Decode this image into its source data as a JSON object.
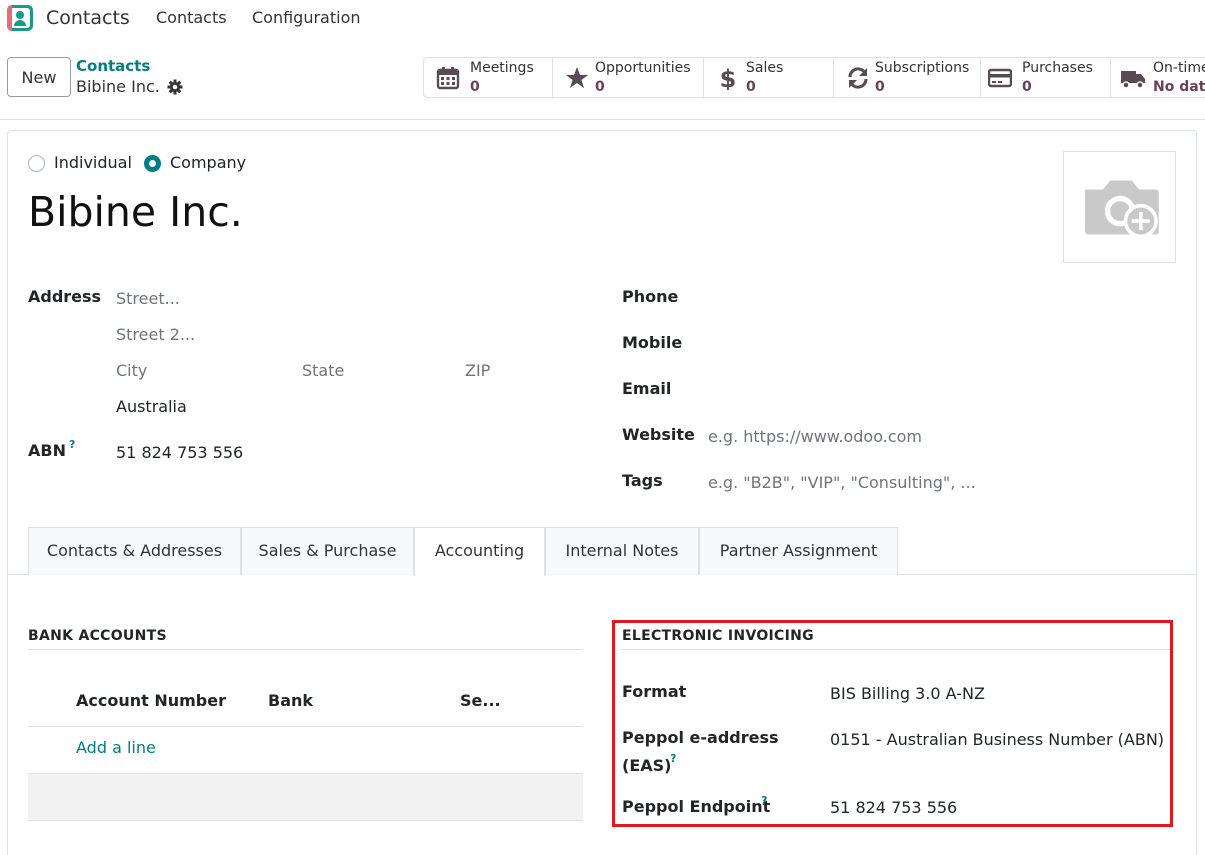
{
  "topnav": {
    "app_name": "Contacts",
    "menu": [
      "Contacts",
      "Configuration"
    ]
  },
  "control_panel": {
    "new_label": "New",
    "breadcrumb_parent": "Contacts",
    "breadcrumb_current": "Bibine Inc.",
    "smart_buttons": [
      {
        "icon": "calendar-icon",
        "label": "Meetings",
        "value": "0"
      },
      {
        "icon": "star-icon",
        "label": "Opportunities",
        "value": "0"
      },
      {
        "icon": "dollar-icon",
        "label": "Sales",
        "value": "0"
      },
      {
        "icon": "refresh-icon",
        "label": "Subscriptions",
        "value": "0"
      },
      {
        "icon": "credit-card-icon",
        "label": "Purchases",
        "value": "0"
      },
      {
        "icon": "truck-icon",
        "label": "On-time",
        "value": "No data"
      }
    ]
  },
  "form": {
    "type_individual": "Individual",
    "type_company": "Company",
    "selected_type": "Company",
    "name": "Bibine Inc.",
    "address_label": "Address",
    "street_ph": "Street...",
    "street2_ph": "Street 2...",
    "city_ph": "City",
    "state_ph": "State",
    "zip_ph": "ZIP",
    "country": "Australia",
    "abn_label": "ABN",
    "abn_help": "?",
    "abn_value": "51 824 753 556",
    "phone_label": "Phone",
    "mobile_label": "Mobile",
    "email_label": "Email",
    "website_label": "Website",
    "website_ph": "e.g. https://www.odoo.com",
    "tags_label": "Tags",
    "tags_ph": "e.g. \"B2B\", \"VIP\", \"Consulting\", ..."
  },
  "tabs": [
    "Contacts & Addresses",
    "Sales & Purchase",
    "Accounting",
    "Internal Notes",
    "Partner Assignment"
  ],
  "active_tab": "Accounting",
  "bank_accounts": {
    "title": "BANK ACCOUNTS",
    "columns": [
      "Account Number",
      "Bank",
      "Se..."
    ],
    "add_line": "Add a line"
  },
  "einvoicing": {
    "title": "ELECTRONIC INVOICING",
    "format_label": "Format",
    "format_value": "BIS Billing 3.0 A-NZ",
    "eas_label_line1": "Peppol e-address",
    "eas_label_line2": "(EAS)",
    "eas_help": "?",
    "eas_value": "0151 - Australian Business Number (ABN)",
    "endpoint_label": "Peppol Endpoint",
    "endpoint_help": "?",
    "endpoint_value": "51 824 753 556"
  },
  "colors": {
    "accent": "#017e84",
    "brand": "#6b3e5b",
    "highlight": "#e1191e"
  }
}
